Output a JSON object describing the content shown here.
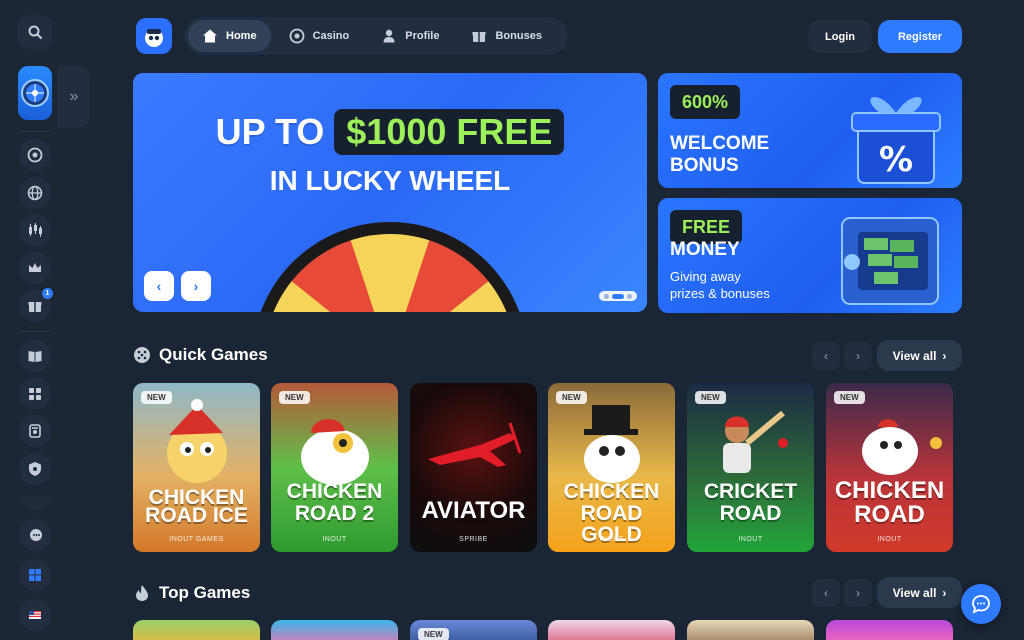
{
  "nav": {
    "items": [
      {
        "label": "Home",
        "icon": "home-icon",
        "active": true
      },
      {
        "label": "Casino",
        "icon": "casino-chip-icon",
        "active": false
      },
      {
        "label": "Profile",
        "icon": "user-icon",
        "active": false
      },
      {
        "label": "Bonuses",
        "icon": "gift-icon",
        "active": false
      }
    ],
    "login": "Login",
    "register": "Register"
  },
  "sidebar": {
    "notification_count": "1"
  },
  "hero": {
    "line1_prefix": "UP TO",
    "line1_highlight": "$1000 FREE",
    "line2": "IN LUCKY WHEEL"
  },
  "promos": [
    {
      "tag": "600%",
      "title_1": "WELCOME",
      "title_2": "BONUS"
    },
    {
      "tag": "FREE",
      "title_1": "MONEY",
      "sub_1": "Giving away",
      "sub_2": "prizes & bonuses"
    }
  ],
  "sections": {
    "quick_games": "Quick Games",
    "top_games": "Top Games",
    "view_all": "View all"
  },
  "quick_games": [
    {
      "new": "NEW",
      "name_1": "CHICKEN",
      "name_2": "ROAD ICE",
      "provider": "INOUT GAMES",
      "color": "#c98a3a"
    },
    {
      "new": "NEW",
      "name_1": "CHICKEN",
      "name_2": "ROAD 2",
      "provider": "INOUT",
      "color": "#3aa63a"
    },
    {
      "new": "",
      "name_1": "AVIATOR",
      "name_2": "",
      "provider": "SPRIBE",
      "color": "#1e1e1e"
    },
    {
      "new": "NEW",
      "name_1": "CHICKEN",
      "name_2": "ROAD GOLD",
      "provider": "INOUT",
      "color": "#e8a93a"
    },
    {
      "new": "NEW",
      "name_1": "CRICKET",
      "name_2": "ROAD",
      "provider": "INOUT",
      "color": "#27a844"
    },
    {
      "new": "NEW",
      "name_1": "CHICKEN",
      "name_2": "ROAD",
      "provider": "INOUT",
      "color": "#c83a3a"
    }
  ],
  "top_games_first_tag": "NEW",
  "colors": {
    "accent": "#2f7bff",
    "highlight_green": "#9df05a",
    "background": "#1a2535"
  }
}
